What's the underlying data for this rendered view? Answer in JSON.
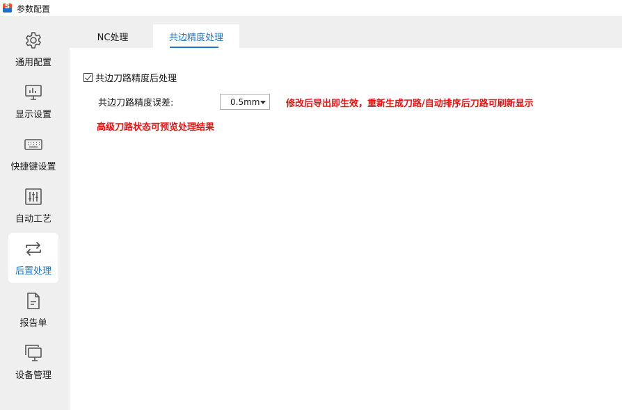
{
  "window": {
    "title": "参数配置",
    "logo_letter": "S",
    "logo_icon": "app-logo-icon"
  },
  "sidebar": {
    "items": [
      {
        "label": "通用配置",
        "icon": "gear-icon",
        "active": false
      },
      {
        "label": "显示设置",
        "icon": "monitor-chart-icon",
        "active": false
      },
      {
        "label": "快捷键设置",
        "icon": "keyboard-icon",
        "active": false
      },
      {
        "label": "自动工艺",
        "icon": "sliders-icon",
        "active": false
      },
      {
        "label": "后置处理",
        "icon": "swap-arrows-icon",
        "active": true
      },
      {
        "label": "报告单",
        "icon": "document-icon",
        "active": false
      },
      {
        "label": "设备管理",
        "icon": "multi-monitor-icon",
        "active": false
      }
    ]
  },
  "tabs": [
    {
      "label": "NC处理",
      "active": false
    },
    {
      "label": "共边精度处理",
      "active": true
    }
  ],
  "settings": {
    "checkbox_label": "共边刀路精度后处理",
    "checkbox_checked": true,
    "tolerance_label": "共边刀路精度误差:",
    "tolerance_value": "0.5mm",
    "note1": "修改后导出即生效，重新生成刀路/自动排序后刀路可刷新显示",
    "note2": "高级刀路状态可预览处理结果"
  },
  "colors": {
    "accent": "#2076c8",
    "warning": "#ee1111",
    "sidebar_bg": "#efefef"
  }
}
